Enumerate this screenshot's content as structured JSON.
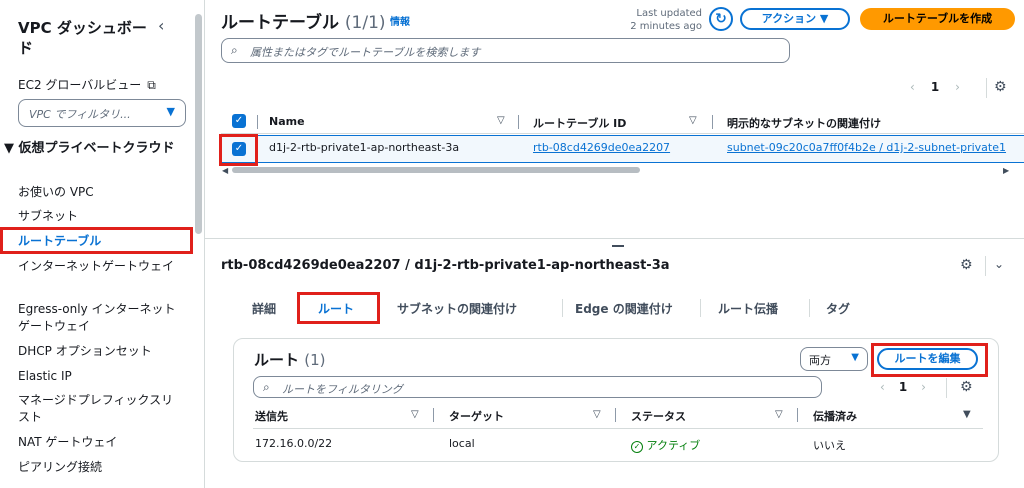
{
  "sidebar": {
    "title": "VPC ダッシュボード",
    "collapse_icon": "chevron-left",
    "ec2_global_view": "EC2 グローバルビュー",
    "filter_placeholder": "VPC でフィルタリ...",
    "section": "仮想プライベートクラウド",
    "items": [
      {
        "label": "お使いの VPC"
      },
      {
        "label": "サブネット"
      },
      {
        "label": "ルートテーブル"
      },
      {
        "label": "インターネットゲートウェイ"
      },
      {
        "label": "Egress-only インターネットゲートウェイ"
      },
      {
        "label": "DHCP オプションセット"
      },
      {
        "label": "Elastic IP"
      },
      {
        "label": "マネージドプレフィックスリスト"
      },
      {
        "label": "NAT ゲートウェイ"
      },
      {
        "label": "ピアリング接続"
      }
    ]
  },
  "header": {
    "title": "ルートテーブル",
    "count": "(1/1)",
    "info": "情報",
    "last_updated_line1": "Last updated",
    "last_updated_line2": "2 minutes ago",
    "action_button": "アクション ▼",
    "create_button": "ルートテーブルを作成",
    "search_placeholder": "属性またはタグでルートテーブルを検索します"
  },
  "pagination": {
    "prev": "‹",
    "page": "1",
    "next": "›"
  },
  "table": {
    "columns": [
      "Name",
      "ルートテーブル ID",
      "明示的なサブネットの関連付け"
    ],
    "rows": [
      {
        "name": "d1j-2-rtb-private1-ap-northeast-3a",
        "id": "rtb-08cd4269de0ea2207",
        "subnet": "subnet-09c20c0a7ff0f4b2e / d1j-2-subnet-private1"
      }
    ]
  },
  "detail": {
    "title": "rtb-08cd4269de0ea2207 / d1j-2-rtb-private1-ap-northeast-3a",
    "tabs": [
      "詳細",
      "ルート",
      "サブネットの関連付け",
      "Edge の関連付け",
      "ルート伝播",
      "タグ"
    ],
    "active_tab": "ルート"
  },
  "routes": {
    "title": "ルート",
    "count": "(1)",
    "filter_select": "両方",
    "edit_button": "ルートを編集",
    "search_placeholder": "ルートをフィルタリング",
    "page": "1",
    "columns": [
      "送信先",
      "ターゲット",
      "ステータス",
      "伝播済み"
    ],
    "rows": [
      {
        "destination": "172.16.0.0/22",
        "target": "local",
        "status": "アクティブ",
        "propagated": "いいえ"
      }
    ]
  },
  "colors": {
    "accent": "#0972d3",
    "primary_button": "#ff9900",
    "highlight": "#e0201b",
    "status_ok": "#037f0c"
  }
}
